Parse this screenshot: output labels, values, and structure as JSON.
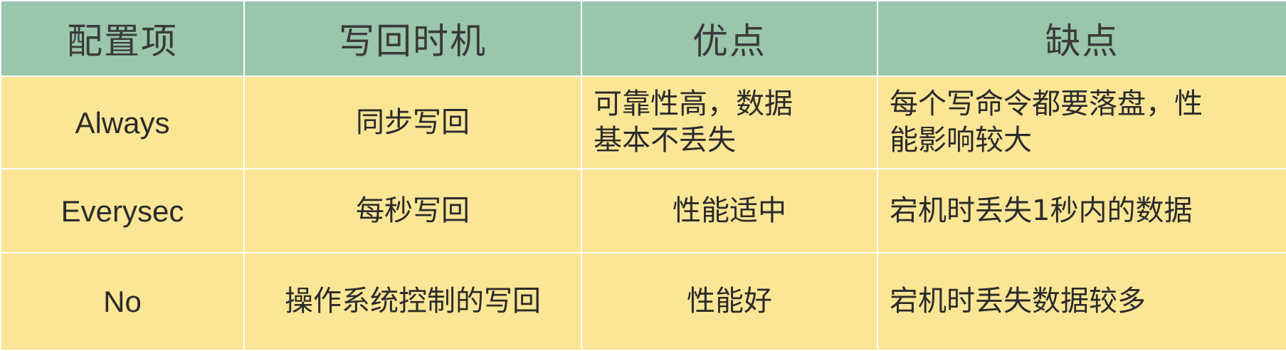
{
  "table": {
    "headers": [
      "配置项",
      "写回时机",
      "优点",
      "缺点"
    ],
    "rows": [
      {
        "config": "Always",
        "timing": "同步写回",
        "pros": [
          "可靠性高，数据",
          "基本不丢失"
        ],
        "cons": [
          "每个写命令都要落盘，性",
          "能影响较大"
        ]
      },
      {
        "config": "Everysec",
        "timing": "每秒写回",
        "pros": [
          "性能适中"
        ],
        "cons": [
          "宕机时丢失1秒内的数据"
        ]
      },
      {
        "config": "No",
        "timing": "操作系统控制的写回",
        "pros": [
          "性能好"
        ],
        "cons": [
          "宕机时丢失数据较多"
        ]
      }
    ]
  },
  "colors": {
    "header_bg": "#9ac6ab",
    "cell_bg": "#fbe696",
    "grid_line": "#ffffff"
  }
}
